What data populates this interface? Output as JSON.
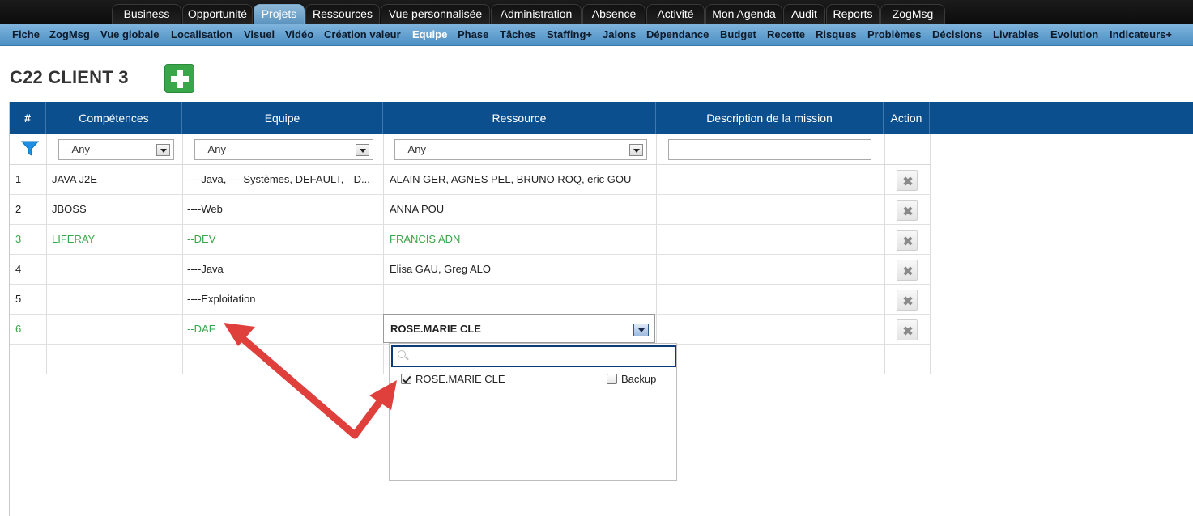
{
  "top_tabs": [
    {
      "label": "Business",
      "active": false
    },
    {
      "label": "Opportunité",
      "active": false
    },
    {
      "label": "Projets",
      "active": true
    },
    {
      "label": "Ressources",
      "active": false
    },
    {
      "label": "Vue personnalisée",
      "active": false
    },
    {
      "label": "Administration",
      "active": false
    },
    {
      "label": "Absence",
      "active": false
    },
    {
      "label": "Activité",
      "active": false
    },
    {
      "label": "Mon Agenda",
      "active": false
    },
    {
      "label": "Audit",
      "active": false
    },
    {
      "label": "Reports",
      "active": false
    },
    {
      "label": "ZogMsg",
      "active": false
    }
  ],
  "sub_nav": [
    {
      "label": "Fiche"
    },
    {
      "label": "ZogMsg"
    },
    {
      "label": "Vue globale"
    },
    {
      "label": "Localisation"
    },
    {
      "label": "Visuel"
    },
    {
      "label": "Vidéo"
    },
    {
      "label": "Création valeur"
    },
    {
      "label": "Equipe",
      "active": true
    },
    {
      "label": "Phase"
    },
    {
      "label": "Tâches"
    },
    {
      "label": "Staffing+"
    },
    {
      "label": "Jalons"
    },
    {
      "label": "Dépendance"
    },
    {
      "label": "Budget"
    },
    {
      "label": "Recette"
    },
    {
      "label": "Risques"
    },
    {
      "label": "Problèmes"
    },
    {
      "label": "Décisions"
    },
    {
      "label": "Livrables"
    },
    {
      "label": "Evolution"
    },
    {
      "label": "Indicateurs+"
    }
  ],
  "page": {
    "title": "C22 CLIENT 3"
  },
  "table": {
    "headers": {
      "num": "#",
      "competences": "Compétences",
      "equipe": "Equipe",
      "ressource": "Ressource",
      "description": "Description de la mission",
      "action": "Action"
    },
    "filters": {
      "competences": "-- Any --",
      "equipe": "-- Any --",
      "ressource": "-- Any --",
      "description": ""
    },
    "rows": [
      {
        "num": "1",
        "competences": "JAVA J2E",
        "equipe": "----Java, ----Systèmes, DEFAULT, --D...",
        "ressource": "ALAIN GER, AGNES PEL, BRUNO ROQ, eric GOU",
        "description": "",
        "highlight": false
      },
      {
        "num": "2",
        "competences": "JBOSS",
        "equipe": "----Web",
        "ressource": "ANNA POU",
        "description": "",
        "highlight": false
      },
      {
        "num": "3",
        "competences": "LIFERAY",
        "equipe": "--DEV",
        "ressource": "FRANCIS ADN",
        "description": "",
        "highlight": true
      },
      {
        "num": "4",
        "competences": "",
        "equipe": "----Java",
        "ressource": "Elisa GAU, Greg ALO",
        "description": "",
        "highlight": false
      },
      {
        "num": "5",
        "competences": "",
        "equipe": "----Exploitation",
        "ressource": "",
        "description": "",
        "highlight": false
      },
      {
        "num": "6",
        "competences": "",
        "equipe": "--DAF",
        "ressource": "",
        "description": "",
        "highlight": true
      }
    ]
  },
  "resource_dropdown": {
    "selected": "ROSE.MARIE CLE",
    "search_value": "",
    "option_label": "ROSE.MARIE CLE",
    "option_checked": true,
    "backup_label": "Backup",
    "backup_checked": false
  },
  "colors": {
    "header_blue": "#0b4f8e",
    "highlight_green": "#3aa64a",
    "annotation_red": "#e0403c"
  }
}
